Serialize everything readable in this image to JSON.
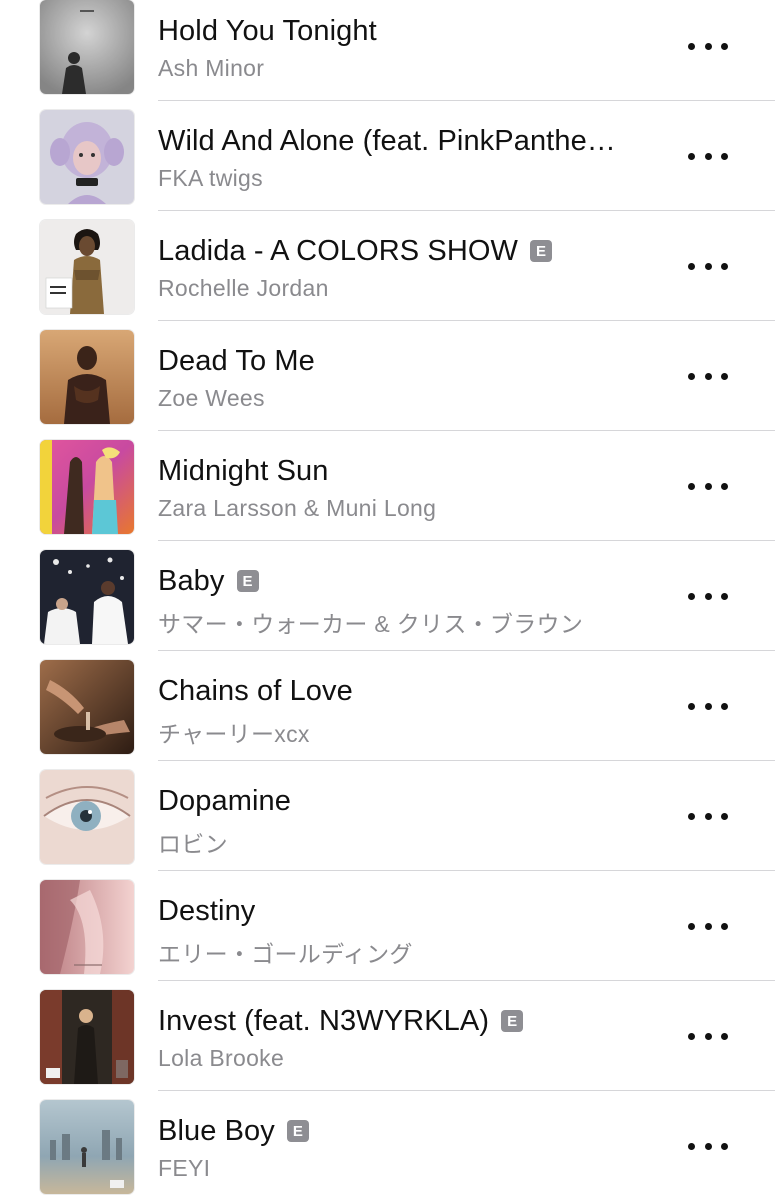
{
  "songs": [
    {
      "title": "Hold You Tonight",
      "artist": "Ash Minor",
      "explicit": false,
      "explicit_label": "",
      "art": "art-hold",
      "colors": [
        "#d9d9d9",
        "#6a6a6a"
      ]
    },
    {
      "title": "Wild And Alone (feat. PinkPanthe…",
      "artist": "FKA twigs",
      "explicit": false,
      "explicit_label": "",
      "art": "art-wild",
      "colors": [
        "#c9c9d8",
        "#b7a3cf"
      ]
    },
    {
      "title": "Ladida - A COLORS SHOW",
      "artist": "Rochelle Jordan",
      "explicit": true,
      "explicit_label": "E",
      "art": "art-ladida",
      "colors": [
        "#e9e6e3",
        "#6b4a2a"
      ]
    },
    {
      "title": "Dead To Me",
      "artist": "Zoe Wees",
      "explicit": false,
      "explicit_label": "",
      "art": "art-dead",
      "colors": [
        "#c08a58",
        "#3b2219"
      ]
    },
    {
      "title": "Midnight Sun",
      "artist": "Zara Larsson & Muni Long",
      "explicit": false,
      "explicit_label": "",
      "art": "art-midnight",
      "colors": [
        "#e64a9c",
        "#ffd45a"
      ]
    },
    {
      "title": "Baby",
      "artist": "サマー・ウォーカー & クリス・ブラウン",
      "explicit": true,
      "explicit_label": "E",
      "art": "art-baby",
      "colors": [
        "#1e2230",
        "#f0f0f0"
      ]
    },
    {
      "title": "Chains of Love",
      "artist": "チャーリーxcx",
      "explicit": false,
      "explicit_label": "",
      "art": "art-chains",
      "colors": [
        "#8a5a3a",
        "#2a1a12"
      ]
    },
    {
      "title": "Dopamine",
      "artist": "ロビン",
      "explicit": false,
      "explicit_label": "",
      "art": "art-dopamine",
      "colors": [
        "#ead6cf",
        "#7da3b8"
      ]
    },
    {
      "title": "Destiny",
      "artist": "エリー・ゴールディング",
      "explicit": false,
      "explicit_label": "",
      "art": "art-destiny",
      "colors": [
        "#c98f92",
        "#f1c9c9"
      ]
    },
    {
      "title": "Invest (feat. N3WYRKLA)",
      "artist": "Lola Brooke",
      "explicit": true,
      "explicit_label": "E",
      "art": "art-invest",
      "colors": [
        "#6a5a45",
        "#2c2620"
      ]
    },
    {
      "title": "Blue Boy",
      "artist": "FEYI",
      "explicit": true,
      "explicit_label": "E",
      "art": "art-blueboy",
      "colors": [
        "#9ab0bd",
        "#c4b49a"
      ]
    }
  ],
  "more_icon": "more-horizontal-icon"
}
